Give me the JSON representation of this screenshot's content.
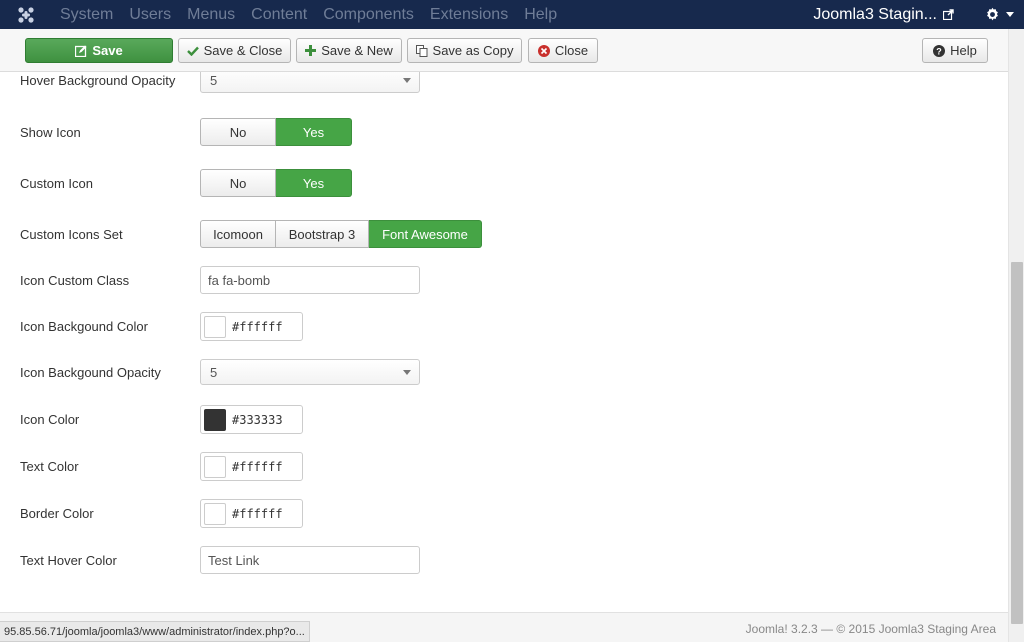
{
  "navbar": {
    "menu": [
      "System",
      "Users",
      "Menus",
      "Content",
      "Components",
      "Extensions",
      "Help"
    ],
    "site_name": "Joomla3 Stagin...",
    "icons": [
      "joomla-logo-icon",
      "external-link-icon",
      "gear-icon",
      "caret-down-icon"
    ]
  },
  "toolbar": {
    "save": "Save",
    "save_close": "Save & Close",
    "save_new": "Save & New",
    "save_copy": "Save as Copy",
    "close": "Close",
    "help": "Help"
  },
  "form": {
    "hover_bg_opacity": {
      "label": "Hover Background Opacity",
      "value": "5"
    },
    "show_icon": {
      "label": "Show Icon",
      "no": "No",
      "yes": "Yes",
      "selected": "Yes"
    },
    "custom_icon": {
      "label": "Custom Icon",
      "no": "No",
      "yes": "Yes",
      "selected": "Yes"
    },
    "custom_icons_set": {
      "label": "Custom Icons Set",
      "options": [
        "Icomoon",
        "Bootstrap 3",
        "Font Awesome"
      ],
      "selected": "Font Awesome"
    },
    "icon_custom_class": {
      "label": "Icon Custom Class",
      "value": "fa fa-bomb"
    },
    "icon_bg_color": {
      "label": "Icon Backgound Color",
      "value": "#ffffff"
    },
    "icon_bg_opacity": {
      "label": "Icon Backgound Opacity",
      "value": "5"
    },
    "icon_color": {
      "label": "Icon Color",
      "value": "#333333"
    },
    "text_color": {
      "label": "Text Color",
      "value": "#ffffff"
    },
    "border_color": {
      "label": "Border Color",
      "value": "#ffffff"
    },
    "text_hover_color": {
      "label": "Text Hover Color",
      "value": "Test Link"
    }
  },
  "footer": {
    "copyright": "Joomla! 3.2.3 — © 2015 Joomla3 Staging Area",
    "status_url": "95.85.56.71/joomla/joomla3/www/administrator/index.php?o..."
  },
  "colors": {
    "navbar_bg": "#17294d",
    "accent_green": "#46a546",
    "close_red": "#c9302c"
  }
}
